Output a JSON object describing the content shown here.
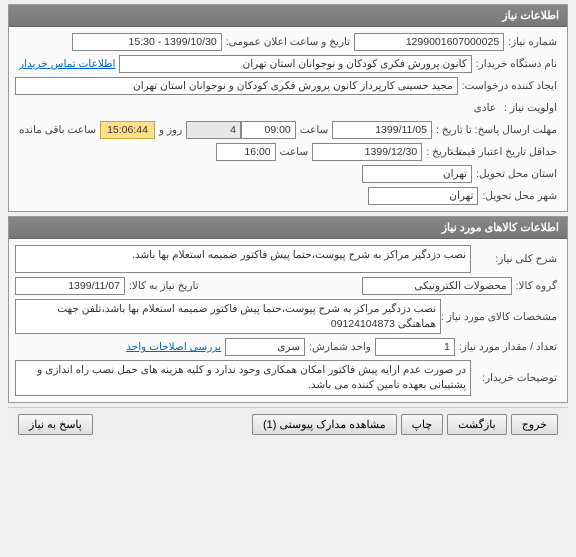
{
  "panel1": {
    "title": "اطلاعات نیاز",
    "row1": {
      "label_num": "شماره نیاز:",
      "num": "1299001607000025",
      "label_announce": "تاریخ و ساعت اعلان عمومی:",
      "announce": "1399/10/30 - 15:30"
    },
    "row2": {
      "label": "نام دستگاه خریدار:",
      "value": "کانون پرورش فکری کودکان و نوجوانان استان تهران",
      "link": "اطلاعات تماس خریدار"
    },
    "row3": {
      "label": "ایجاد کننده درخواست:",
      "value": "مجید حسینی کارپرداز کانون پرورش فکری کودکان و نوجوانان استان تهران"
    },
    "row4": {
      "label": "اولویت نیاز :",
      "value": "عادی"
    },
    "row5": {
      "label1": "مهلت ارسال پاسخ:  تا تاریخ :",
      "date": "1399/11/05",
      "label2": "ساعت",
      "time": "09:00",
      "days": "4",
      "label3": "روز و",
      "remain": "15:06:44",
      "label4": "ساعت باقی مانده"
    },
    "row6": {
      "label1": "حداقل تاریخ اعتبار قیمت:",
      "label2": "تا تاریخ :",
      "date": "1399/12/30",
      "label3": "ساعت",
      "time": "16:00"
    },
    "row7": {
      "label": "استان محل تحویل:",
      "value": "تهران"
    },
    "row8": {
      "label": "شهر محل تحویل:",
      "value": "تهران"
    }
  },
  "panel2": {
    "title": "اطلاعات کالاهای مورد نیاز",
    "row1": {
      "label": "شرح کلی نیاز:",
      "value": "نصب دزدگیر مراکز به شرح پیوست،حتما پیش فاکتور ضمیمه استعلام بها باشد."
    },
    "row2": {
      "label1": "گروه کالا:",
      "value1": "محصولات الکترونیکی",
      "label2": "تاریخ نیاز به کالا:",
      "value2": "1399/11/07"
    },
    "row3": {
      "label": "مشخصات کالای مورد نیاز :",
      "value": "نصب دزدگیر مراکز به شرح پیوست،حتما پیش فاکتور ضمیمه استعلام بها باشد،تلفن جهت هماهنگی 09124104873"
    },
    "row4": {
      "label1": "تعداد / مقدار مورد نیاز:",
      "value1": "1",
      "label2": "واحد شمارش:",
      "value2": "سری",
      "link": "بررسی اصلاحات واحد"
    },
    "row5": {
      "label": "توضیحات خریدار:",
      "value": "در صورت عدم ارایه پیش فاکتور امکان همکاری وجود ندارد و کلیه هزینه های حمل نصب راه اندازی و پشتیبانی بعهده تامین کننده می باشد."
    }
  },
  "buttons": {
    "reply": "پاسخ به نیاز",
    "attachments": "مشاهده مدارک پیوستی (1)",
    "print": "چاپ",
    "back": "بازگشت",
    "exit": "خروج"
  }
}
